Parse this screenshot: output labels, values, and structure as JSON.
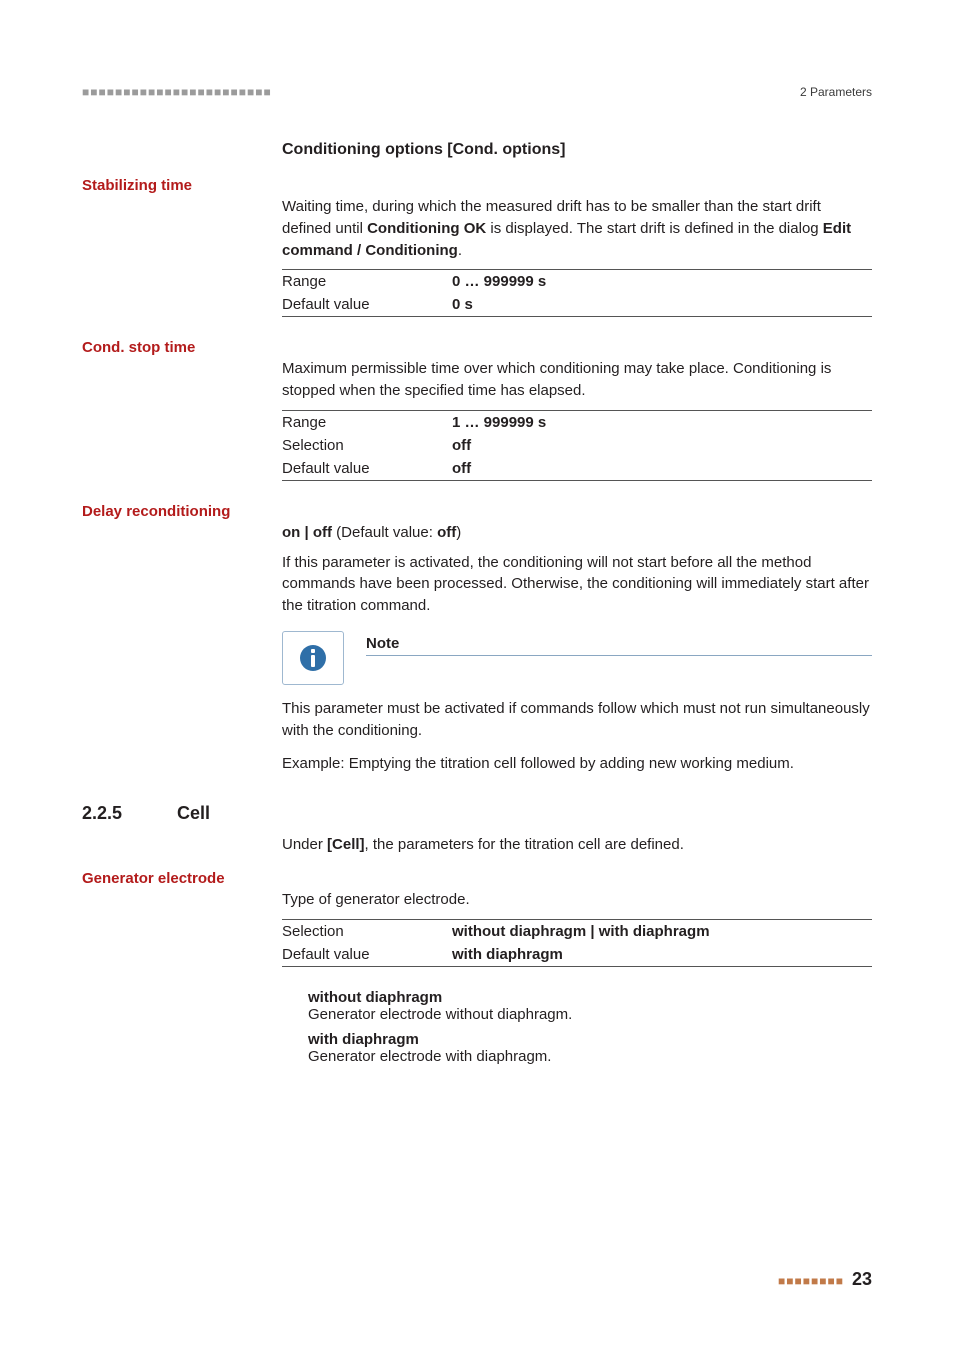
{
  "header": {
    "dashes": "■■■■■■■■■■■■■■■■■■■■■■■",
    "section": "2 Parameters"
  },
  "h3": "Conditioning options [Cond. options]",
  "stabilizing": {
    "label": "Stabilizing time",
    "desc_pre": "Waiting time, during which the measured drift has to be smaller than the start drift defined until ",
    "desc_bold1": "Conditioning OK",
    "desc_mid": " is displayed. The start drift is defined in the dialog ",
    "desc_bold2": "Edit command / Conditioning",
    "desc_post": ".",
    "rows": [
      {
        "k": "Range",
        "v": "0 … 999999 s"
      },
      {
        "k": "Default value",
        "v": "0 s"
      }
    ]
  },
  "condstop": {
    "label": "Cond. stop time",
    "desc": "Maximum permissible time over which conditioning may take place. Conditioning is stopped when the specified time has elapsed.",
    "rows": [
      {
        "k": "Range",
        "v": "1 … 999999 s"
      },
      {
        "k": "Selection",
        "v": "off"
      },
      {
        "k": "Default value",
        "v": "off"
      }
    ]
  },
  "delay": {
    "label": "Delay reconditioning",
    "choice_pre": "on | off",
    "choice_mid": " (Default value: ",
    "choice_bold": "off",
    "choice_post": ")",
    "desc": "If this parameter is activated, the conditioning will not start before all the method commands have been processed. Otherwise, the conditioning will immediately start after the titration command.",
    "note_title": "Note",
    "note_p1": "This parameter must be activated if commands follow which must not run simultaneously with the conditioning.",
    "note_p2": "Example: Emptying the titration cell followed by adding new working medium."
  },
  "cell": {
    "num": "2.2.5",
    "title": "Cell",
    "intro_pre": "Under ",
    "intro_bold": "[Cell]",
    "intro_post": ", the parameters for the titration cell are defined.",
    "gen_label": "Generator electrode",
    "gen_desc": "Type of generator electrode.",
    "rows": [
      {
        "k": "Selection",
        "v": "without diaphragm | with diaphragm"
      },
      {
        "k": "Default value",
        "v": "with diaphragm"
      }
    ],
    "defs": [
      {
        "term": "without diaphragm",
        "desc": "Generator electrode without diaphragm."
      },
      {
        "term": "with diaphragm",
        "desc": "Generator electrode with diaphragm."
      }
    ]
  },
  "footer": {
    "dashes": "■■■■■■■■",
    "page": "23"
  }
}
